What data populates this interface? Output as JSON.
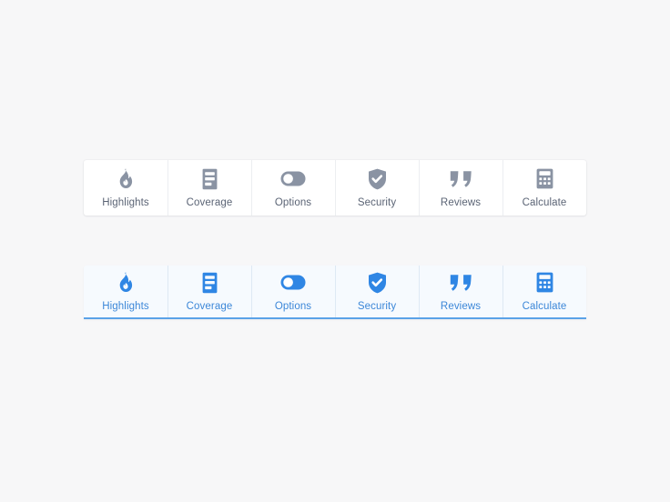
{
  "page": {
    "background_color": "#f7f7f8"
  },
  "tab_bars": [
    {
      "state": "inactive",
      "label_color": "#5b6475",
      "icon_color": "#8a93a3",
      "background_color": "#ffffff",
      "divider_color": "#eceef1",
      "underline_color": "",
      "tabs": [
        {
          "label": "Highlights",
          "icon": "flame-icon"
        },
        {
          "label": "Coverage",
          "icon": "document-list-icon"
        },
        {
          "label": "Options",
          "icon": "toggle-switch-icon"
        },
        {
          "label": "Security",
          "icon": "shield-check-icon"
        },
        {
          "label": "Reviews",
          "icon": "quote-marks-icon"
        },
        {
          "label": "Calculate",
          "icon": "calculator-icon"
        }
      ]
    },
    {
      "state": "active",
      "label_color": "#3c87d8",
      "icon_color": "#2f86e4",
      "background_color": "#f6fafe",
      "divider_color": "#dee9f4",
      "underline_color": "#5aa2e8",
      "tabs": [
        {
          "label": "Highlights",
          "icon": "flame-icon"
        },
        {
          "label": "Coverage",
          "icon": "document-list-icon"
        },
        {
          "label": "Options",
          "icon": "toggle-switch-icon"
        },
        {
          "label": "Security",
          "icon": "shield-check-icon"
        },
        {
          "label": "Reviews",
          "icon": "quote-marks-icon"
        },
        {
          "label": "Calculate",
          "icon": "calculator-icon"
        }
      ]
    }
  ]
}
